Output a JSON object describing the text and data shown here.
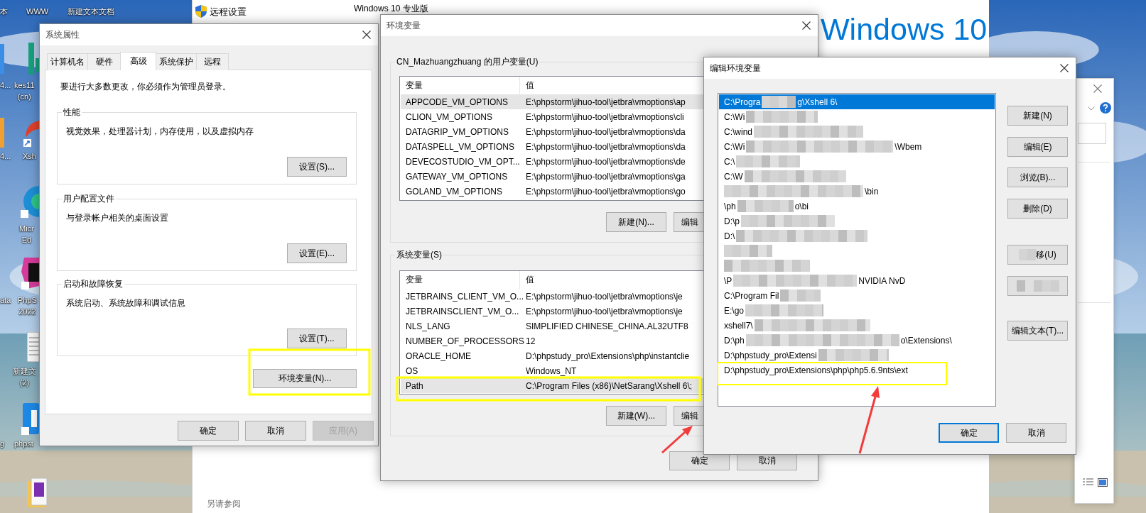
{
  "desktop": {
    "icons": [
      {
        "lines": [
          "本"
        ]
      },
      {
        "lines": [
          "WWW"
        ]
      },
      {
        "lines": [
          "新建文本文档"
        ]
      },
      {
        "lines": [
          "4..."
        ]
      },
      {
        "lines": [
          "kes11",
          "(cn)"
        ]
      },
      {
        "lines": [
          "4..."
        ]
      },
      {
        "lines": [
          "Xsh"
        ]
      },
      {
        "lines": [
          "Micr",
          "Ed"
        ]
      },
      {
        "lines": [
          "ata"
        ]
      },
      {
        "lines": [
          "PhpS",
          "2022"
        ]
      },
      {
        "lines": [
          "新建文",
          "(2)"
        ]
      },
      {
        "lines": [
          "g"
        ]
      },
      {
        "lines": [
          "phpst"
        ]
      }
    ]
  },
  "settings_window": {
    "link": "远程设置",
    "heading": "Windows 10 专业版",
    "logo": "Windows 10",
    "see_also": "另请参阅"
  },
  "system_properties": {
    "title": "系统属性",
    "tabs": [
      {
        "label": "计算机名",
        "selected": false
      },
      {
        "label": "硬件",
        "selected": false
      },
      {
        "label": "高级",
        "selected": true
      },
      {
        "label": "系统保护",
        "selected": false
      },
      {
        "label": "远程",
        "selected": false
      }
    ],
    "notice": "要进行大多数更改，你必须作为管理员登录。",
    "groups": [
      {
        "title": "性能",
        "description": "视觉效果，处理器计划，内存使用，以及虚拟内存",
        "button": "设置(S)..."
      },
      {
        "title": "用户配置文件",
        "description": "与登录帐户相关的桌面设置",
        "button": "设置(E)..."
      },
      {
        "title": "启动和故障恢复",
        "description": "系统启动、系统故障和调试信息",
        "button": "设置(T)..."
      }
    ],
    "env_button": "环境变量(N)...",
    "buttons": [
      {
        "label": "确定",
        "disabled": false
      },
      {
        "label": "取消",
        "disabled": false
      },
      {
        "label": "应用(A)",
        "disabled": true
      }
    ]
  },
  "environment_variables": {
    "title": "环境变量",
    "user_vars": {
      "title": "CN_Mazhuangzhuang 的用户变量(U)",
      "columns": [
        "变量",
        "值"
      ],
      "rows": [
        {
          "name": "APPCODE_VM_OPTIONS",
          "value": "E:\\phpstorm\\jihuo-tool\\jetbra\\vmoptions\\ap",
          "selected": true
        },
        {
          "name": "CLION_VM_OPTIONS",
          "value": "E:\\phpstorm\\jihuo-tool\\jetbra\\vmoptions\\cli",
          "selected": false
        },
        {
          "name": "DATAGRIP_VM_OPTIONS",
          "value": "E:\\phpstorm\\jihuo-tool\\jetbra\\vmoptions\\da",
          "selected": false
        },
        {
          "name": "DATASPELL_VM_OPTIONS",
          "value": "E:\\phpstorm\\jihuo-tool\\jetbra\\vmoptions\\da",
          "selected": false
        },
        {
          "name": "DEVECOSTUDIO_VM_OPT...",
          "value": "E:\\phpstorm\\jihuo-tool\\jetbra\\vmoptions\\de",
          "selected": false
        },
        {
          "name": "GATEWAY_VM_OPTIONS",
          "value": "E:\\phpstorm\\jihuo-tool\\jetbra\\vmoptions\\ga",
          "selected": false
        },
        {
          "name": "GOLAND_VM_OPTIONS",
          "value": "E:\\phpstorm\\jihuo-tool\\jetbra\\vmoptions\\go",
          "selected": false
        }
      ],
      "buttons": [
        "新建(N)...",
        "编辑"
      ]
    },
    "system_vars": {
      "title": "系统变量(S)",
      "columns": [
        "变量",
        "值"
      ],
      "rows": [
        {
          "name": "JETBRAINS_CLIENT_VM_O...",
          "value": "E:\\phpstorm\\jihuo-tool\\jetbra\\vmoptions\\je",
          "selected": false
        },
        {
          "name": "JETBRAINSCLIENT_VM_O...",
          "value": "E:\\phpstorm\\jihuo-tool\\jetbra\\vmoptions\\je",
          "selected": false
        },
        {
          "name": "NLS_LANG",
          "value": "SIMPLIFIED CHINESE_CHINA.AL32UTF8",
          "selected": false
        },
        {
          "name": "NUMBER_OF_PROCESSORS",
          "value": "12",
          "selected": false
        },
        {
          "name": "ORACLE_HOME",
          "value": "D:\\phpstudy_pro\\Extensions\\php\\instantclie",
          "selected": false
        },
        {
          "name": "OS",
          "value": "Windows_NT",
          "selected": false
        },
        {
          "name": "Path",
          "value": "C:\\Program Files (x86)\\NetSarang\\Xshell 6\\;",
          "selected": true
        }
      ],
      "buttons": [
        "新建(W)...",
        "编辑"
      ]
    },
    "buttons": [
      "确定",
      "取消"
    ]
  },
  "edit_environment_variable": {
    "title": "编辑环境变量",
    "entries": [
      {
        "text": "C:\\Progra",
        "tail": "g\\Xshell 6\\",
        "redacted": true,
        "selected": true
      },
      {
        "text": "C:\\Wi",
        "redacted": true,
        "selected": false
      },
      {
        "text": "C:\\wind",
        "redacted": true,
        "selected": false
      },
      {
        "text": "C:\\Wi",
        "tail": "\\Wbem",
        "redacted": true,
        "selected": false
      },
      {
        "text": "C:\\",
        "redacted": true,
        "selected": false
      },
      {
        "text": "C:\\W",
        "redacted": true,
        "selected": false
      },
      {
        "tail": "\\bin",
        "redacted": true,
        "selected": false
      },
      {
        "text": "\\ph",
        "tail": "o\\bi",
        "redacted": true,
        "selected": false
      },
      {
        "text": "D:\\p",
        "redacted": true,
        "selected": false
      },
      {
        "text": "D:\\",
        "redacted": true,
        "selected": false
      },
      {
        "redacted": true,
        "selected": false
      },
      {
        "redacted": true,
        "selected": false
      },
      {
        "text": "\\P",
        "tail": "NVIDIA NvD",
        "redacted": true,
        "selected": false
      },
      {
        "text": "C:\\Program Fil",
        "redacted": true,
        "selected": false
      },
      {
        "text": "E:\\go",
        "redacted": true,
        "selected": false
      },
      {
        "text": "xshell7\\",
        "redacted": true,
        "selected": false
      },
      {
        "text": "D:\\ph",
        "tail": "o\\Extensions\\",
        "redacted": true,
        "selected": false
      },
      {
        "text": "D:\\phpstudy_pro\\Extensi",
        "redacted": true,
        "selected": false
      },
      {
        "text": "D:\\phpstudy_pro\\Extensions\\php\\php5.6.9nts\\ext",
        "redacted": false,
        "selected": false
      }
    ],
    "buttons": [
      {
        "label": "新建(N)",
        "redacted": false
      },
      {
        "label": "编辑(E)",
        "redacted": false
      },
      {
        "label": "浏览(B)...",
        "redacted": false
      },
      {
        "label": "删除(D)",
        "redacted": false
      },
      {
        "label": "移(U)",
        "redacted": true
      },
      {
        "redacted": true
      },
      {
        "label": "编辑文本(T)...",
        "redacted": false
      }
    ],
    "footer_buttons": [
      {
        "label": "确定",
        "default": true
      },
      {
        "label": "取消",
        "default": false
      }
    ]
  }
}
